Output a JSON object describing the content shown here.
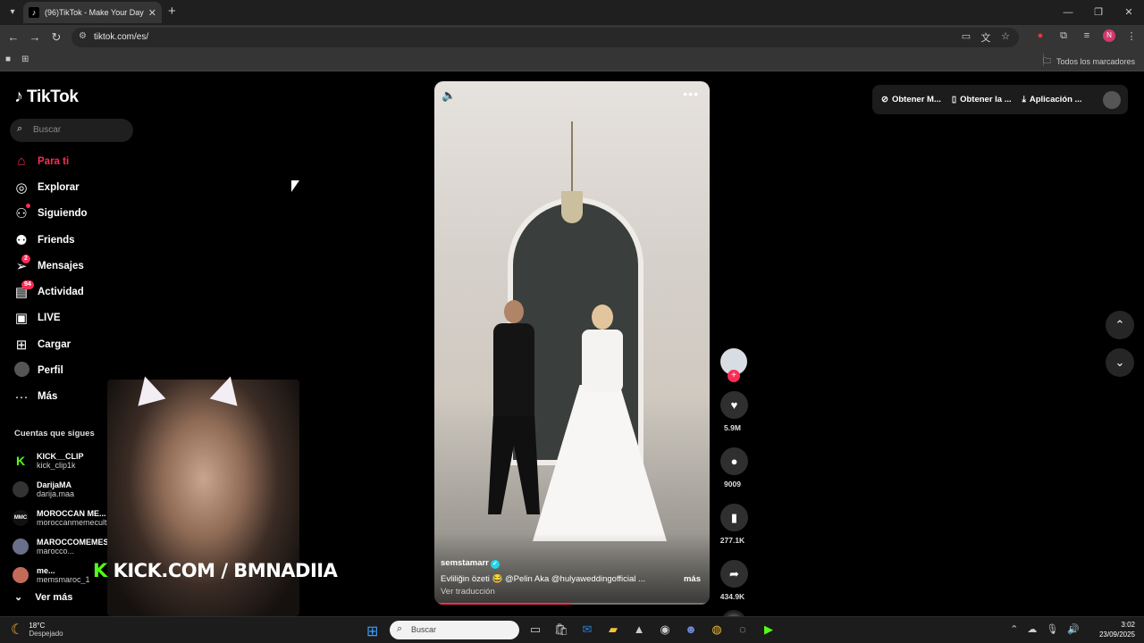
{
  "browser": {
    "tab_title": "(96)TikTok - Make Your Day",
    "url": "tiktok.com/es/",
    "bookmarks_label": "Todos los marcadores",
    "profile_initial": "N"
  },
  "sidebar": {
    "logo": "TikTok",
    "search_placeholder": "Buscar",
    "items": [
      {
        "label": "Para ti",
        "icon": "home-icon"
      },
      {
        "label": "Explorar",
        "icon": "compass-icon"
      },
      {
        "label": "Siguiendo",
        "icon": "following-icon"
      },
      {
        "label": "Friends",
        "icon": "friends-icon"
      },
      {
        "label": "Mensajes",
        "icon": "messages-icon",
        "badge": "2"
      },
      {
        "label": "Actividad",
        "icon": "activity-icon",
        "badge": "94"
      },
      {
        "label": "LIVE",
        "icon": "live-icon"
      },
      {
        "label": "Cargar",
        "icon": "upload-icon"
      },
      {
        "label": "Perfil",
        "icon": "profile-icon"
      },
      {
        "label": "Más",
        "icon": "more-icon"
      }
    ],
    "following_header": "Cuentas que sigues",
    "following": [
      {
        "name": "KICK__CLIP",
        "handle": "kick_clip1k"
      },
      {
        "name": "DarijaMA",
        "handle": "darija.maa"
      },
      {
        "name": "MOROCCAN ME...",
        "handle": "moroccanmemecult..."
      },
      {
        "name": "MAROCCOMEMES",
        "handle": "marocco..."
      },
      {
        "name": "me...",
        "handle": "memsmaroc_1"
      }
    ],
    "see_more": "Ver más"
  },
  "overlay": {
    "kick_k": "K",
    "kick_text": "KICK.COM / BMNADIIA"
  },
  "video": {
    "author": "semstamarr",
    "caption": "Evliliğin özeti 😂 @Pelin Aka @hulyaweddingofficial ...",
    "more": "más",
    "translate": "Ver traducción",
    "progress_pct": 50
  },
  "actions": {
    "likes": "5.9M",
    "comments": "9009",
    "saves": "277.1K",
    "shares": "434.9K"
  },
  "topright": {
    "item1": "Obtener M...",
    "item2": "Obtener la ...",
    "item3": "Aplicación ..."
  },
  "taskbar": {
    "temp": "18°C",
    "weather": "Despejado",
    "search_placeholder": "Buscar",
    "time": "3:02",
    "date": "23/09/2025"
  },
  "colors": {
    "accent": "#fe2c55",
    "kick_green": "#53fc18"
  }
}
